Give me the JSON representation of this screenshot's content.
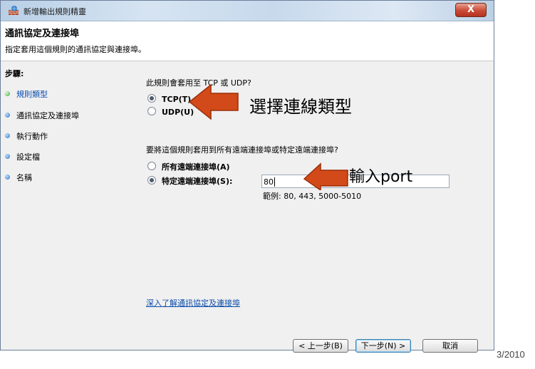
{
  "window": {
    "title": "新增輸出規則精靈",
    "close_label": "X"
  },
  "header": {
    "title": "通訊協定及連接埠",
    "subtitle": "指定套用這個規則的通訊協定與連接埠。"
  },
  "steps": {
    "title": "步驟:",
    "items": [
      {
        "label": "規則類型",
        "state": "done"
      },
      {
        "label": "通訊協定及連接埠",
        "state": "current"
      },
      {
        "label": "執行動作",
        "state": "pending"
      },
      {
        "label": "設定檔",
        "state": "pending"
      },
      {
        "label": "名稱",
        "state": "pending"
      }
    ]
  },
  "protocol": {
    "question": "此規則會套用至 TCP 或 UDP?",
    "tcp_label": "TCP(T)",
    "udp_label": "UDP(U)",
    "selected": "TCP(T)"
  },
  "ports": {
    "question": "要將這個規則套用到所有遠端連接埠或特定遠端連接埠?",
    "all_label": "所有遠端連接埠(A)",
    "specific_label": "特定遠端連接埠(S):",
    "selected": "特定遠端連接埠(S):",
    "input_value": "80",
    "example": "範例: 80, 443, 5000-5010"
  },
  "help_link": "深入了解通訊協定及連接埠",
  "buttons": {
    "back": "< 上一步(B)",
    "next": "下一步(N) >",
    "cancel": "取消"
  },
  "annotations": {
    "choose_type": "選擇連線類型",
    "enter_port": "輸入port"
  },
  "fragment": "3/2010",
  "colors": {
    "arrow": "#d24a1a",
    "link": "#0b4dad"
  },
  "icons": {
    "app": "firewall-icon",
    "close": "close-icon"
  }
}
